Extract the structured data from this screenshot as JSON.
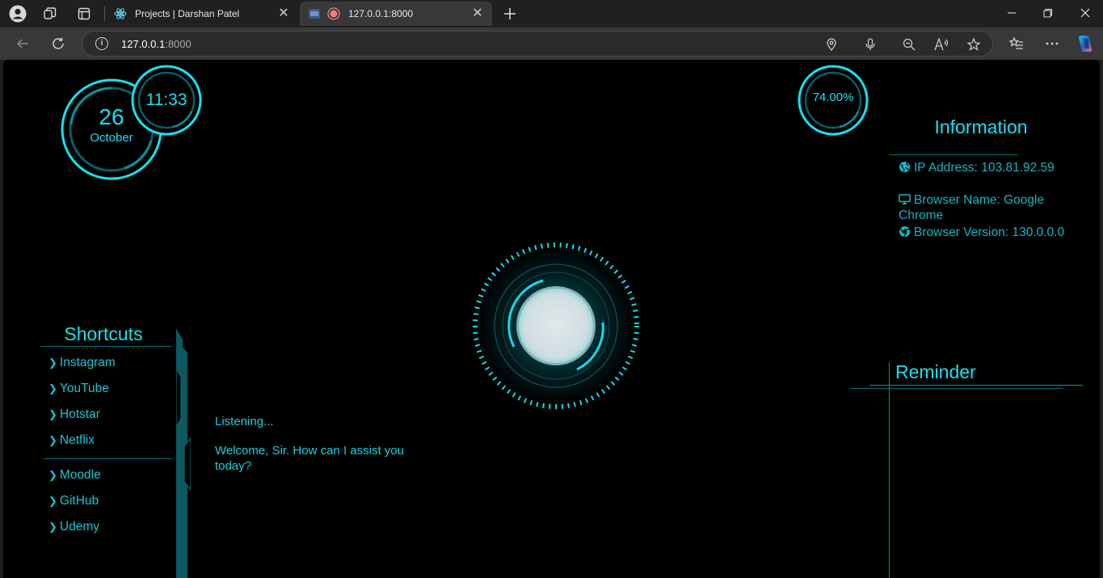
{
  "browser": {
    "tabs": [
      {
        "title": "Projects | Darshan Patel",
        "favicon": "react-icon",
        "active": false
      },
      {
        "title": "127.0.0.1:8000",
        "favicon": "recording-icon",
        "active": true
      }
    ],
    "address": {
      "host": "127.0.0.1",
      "port": ":8000"
    }
  },
  "dashboard": {
    "date": {
      "day": "26",
      "month": "October"
    },
    "time": "11:33",
    "battery": "74.00%",
    "information": {
      "title": "Information",
      "ip": "IP Address: 103.81.92.59",
      "browser_name": "Browser Name: Google Chrome",
      "browser_version": "Browser Version: 130.0.0.0"
    },
    "shortcuts": {
      "title": "Shortcuts",
      "group1": [
        "Instagram",
        "YouTube",
        "Hotstar",
        "Netflix"
      ],
      "group2": [
        "Moodle",
        "GitHub",
        "Udemy"
      ]
    },
    "chat": {
      "status": "Listening...",
      "message": "Welcome, Sir. How can I assist you today?"
    },
    "reminder": {
      "title": "Reminder"
    }
  },
  "colors": {
    "accent": "#00e5ff",
    "accent_dim": "#0b6d74",
    "background": "#000000"
  }
}
